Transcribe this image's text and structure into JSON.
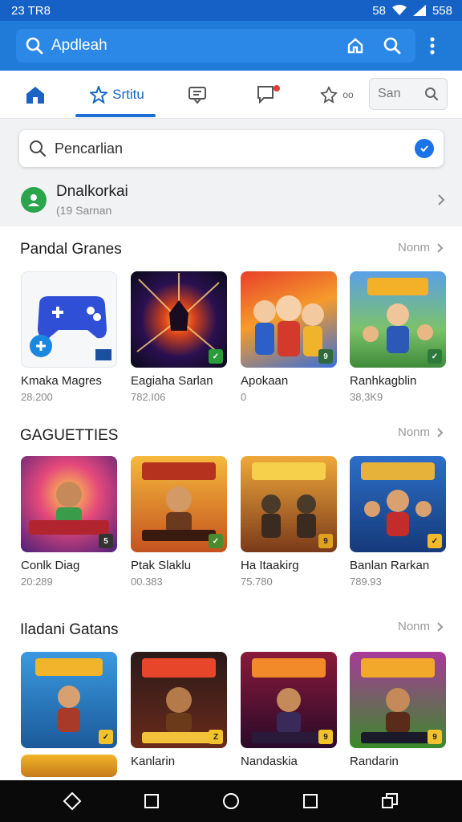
{
  "status": {
    "time": "23 TR8",
    "right": "58",
    "battery": "558"
  },
  "appbar": {
    "search_label": "Apdleah"
  },
  "tabs": [
    {
      "label": ""
    },
    {
      "label": "Srtitu"
    },
    {
      "label": ""
    },
    {
      "label": ""
    },
    {
      "label": "oo"
    }
  ],
  "tab_search": {
    "label": "San"
  },
  "main_search": {
    "label": "Pencarlian"
  },
  "location": {
    "title": "Dnalkorkai",
    "subtitle": "(19 Sarnan"
  },
  "sections": [
    {
      "title": "Pandal Granes",
      "more": "Nonm",
      "items": [
        {
          "name": "Kmaka Magres",
          "value": "28.200"
        },
        {
          "name": "Eagiaha Sarlan",
          "value": "782.I06"
        },
        {
          "name": "Apokaan",
          "value": "0"
        },
        {
          "name": "Ranhkagblin",
          "value": "38,3K9"
        }
      ]
    },
    {
      "title": "GAGUETTIES",
      "more": "Nonm",
      "items": [
        {
          "name": "Conlk Diag",
          "value": "20:289"
        },
        {
          "name": "Ptak Slaklu",
          "value": "00.383"
        },
        {
          "name": "Ha Itaakirg",
          "value": "75.780"
        },
        {
          "name": "Banlan Rarkan",
          "value": "789.93"
        }
      ]
    },
    {
      "title": "Iladani Gatans",
      "more": "Nonm",
      "items": [
        {
          "name": "",
          "value": ""
        },
        {
          "name": "Kanlarin",
          "value": ""
        },
        {
          "name": "Nandaskia",
          "value": ""
        },
        {
          "name": "Randarin",
          "value": ""
        }
      ]
    }
  ],
  "colors": {
    "brand": "#1f7ad8",
    "accent": "#1667c8",
    "statusbar": "#1561c6"
  }
}
